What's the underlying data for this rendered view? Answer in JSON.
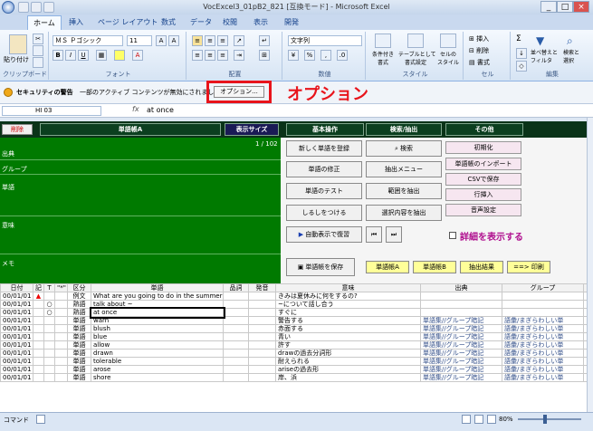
{
  "window": {
    "title": "VocExcel3_01pB2_821 [互換モード] - Microsoft Excel"
  },
  "tabs": [
    "ホーム",
    "挿入",
    "ページ レイアウト",
    "数式",
    "データ",
    "校閲",
    "表示",
    "開発"
  ],
  "ribbon": {
    "paste": "貼り付け",
    "clipboard": "クリップボード",
    "font_name": "ＭＳ Ｐゴシック",
    "font_size": "11",
    "font_group": "フォント",
    "align_group": "配置",
    "number_format": "文字列",
    "number_group": "数値",
    "style_btn1": "条件付き\n書式",
    "style_btn2": "テーブルとして\n書式設定",
    "style_btn3": "セルの\nスタイル",
    "style_group": "スタイル",
    "cells_insert": "挿入",
    "cells_delete": "削除",
    "cells_format": "書式",
    "cells_group": "セル",
    "sort": "並べ替えと\nフィルタ",
    "find": "検索と\n選択",
    "edit_group": "編集"
  },
  "security": {
    "label": "セキュリティの警告",
    "message": "一部のアクティブ コンテンツが無効にされました。",
    "options_button": "オプション...",
    "callout": "オプション"
  },
  "formula_bar": {
    "name_box": "HI 03",
    "fx": "fx",
    "value": "at once"
  },
  "panel": {
    "delete_btn": "削除",
    "vocab_header": "単語帳A",
    "display_size": "表示サイズ",
    "basic_ops": "基本操作",
    "search_extract": "検索/抽出",
    "other": "その他",
    "counter": "1 / 102",
    "field_source": "出典",
    "field_group": "グループ",
    "field_word": "単語",
    "field_meaning": "意味",
    "field_memo": "メモ",
    "btn_register": "新しく単語を登録",
    "btn_search": "検索",
    "btn_init": "初期化",
    "btn_edit": "単語の修正",
    "btn_extract_menu": "抽出メニュー",
    "btn_import": "単語帳のインポート",
    "btn_test": "単語のテスト",
    "btn_range": "範囲を抽出",
    "btn_csv": "CSVで保存",
    "btn_mark": "しるしをつける",
    "btn_selection": "選択内容を抽出",
    "btn_row_insert": "行挿入",
    "btn_auto": "自動表示で復習",
    "btn_audio": "音声設定",
    "show_detail": "詳細を表示する",
    "btn_save": "単語帳を保存",
    "btn_vocab_a": "単語帳A",
    "btn_vocab_b": "単語帳B",
    "btn_extract_result": "抽出結果",
    "btn_print": "==> 印刷"
  },
  "table": {
    "headers": [
      "日付",
      "記",
      "T",
      "\"*\"",
      "区分",
      "単語",
      "品詞",
      "発音",
      "意味",
      "出典",
      "グループ",
      "テ"
    ],
    "rows": [
      [
        "00/01/01",
        "▲",
        "",
        "",
        "例文",
        "What are you going to do in the summer",
        "",
        "",
        "きみは夏休みに何をするの?",
        "",
        ""
      ],
      [
        "00/01/01",
        "",
        "○",
        "",
        "熟語",
        "talk about ~",
        "",
        "",
        "~について話し合う",
        "",
        ""
      ],
      [
        "00/01/01",
        "",
        "○",
        "",
        "熟語",
        "at once",
        "",
        "",
        "すぐに",
        "",
        ""
      ],
      [
        "00/01/01",
        "",
        "",
        "",
        "単語",
        "warn",
        "",
        "",
        "警告する",
        "単語集//グループ暗記",
        "語彙/まぎらわしい単"
      ],
      [
        "00/01/01",
        "",
        "",
        "",
        "単語",
        "blush",
        "",
        "",
        "赤面する",
        "単語集//グループ暗記",
        "語彙/まぎらわしい単"
      ],
      [
        "00/01/01",
        "",
        "",
        "",
        "単語",
        "blue",
        "",
        "",
        "青い",
        "単語集//グループ暗記",
        "語彙/まぎらわしい単"
      ],
      [
        "00/01/01",
        "",
        "",
        "",
        "単語",
        "allow",
        "",
        "",
        "許す",
        "単語集//グループ暗記",
        "語彙/まぎらわしい単"
      ],
      [
        "00/01/01",
        "",
        "",
        "",
        "単語",
        "drawn",
        "",
        "",
        "drawの過去分詞形",
        "単語集//グループ暗記",
        "語彙/まぎらわしい単"
      ],
      [
        "00/01/01",
        "",
        "",
        "",
        "単語",
        "tolerable",
        "",
        "",
        "耐えられる",
        "単語集//グループ暗記",
        "語彙/まぎらわしい単"
      ],
      [
        "00/01/01",
        "",
        "",
        "",
        "単語",
        "arose",
        "",
        "",
        "ariseの過去形",
        "単語集//グループ暗記",
        "語彙/まぎらわしい単"
      ],
      [
        "00/01/01",
        "",
        "",
        "",
        "単語",
        "shore",
        "",
        "",
        "岸、浜",
        "単語集//グループ暗記",
        "語彙/まぎらわしい単"
      ]
    ]
  },
  "status": {
    "mode": "コマンド",
    "zoom": "80%"
  }
}
